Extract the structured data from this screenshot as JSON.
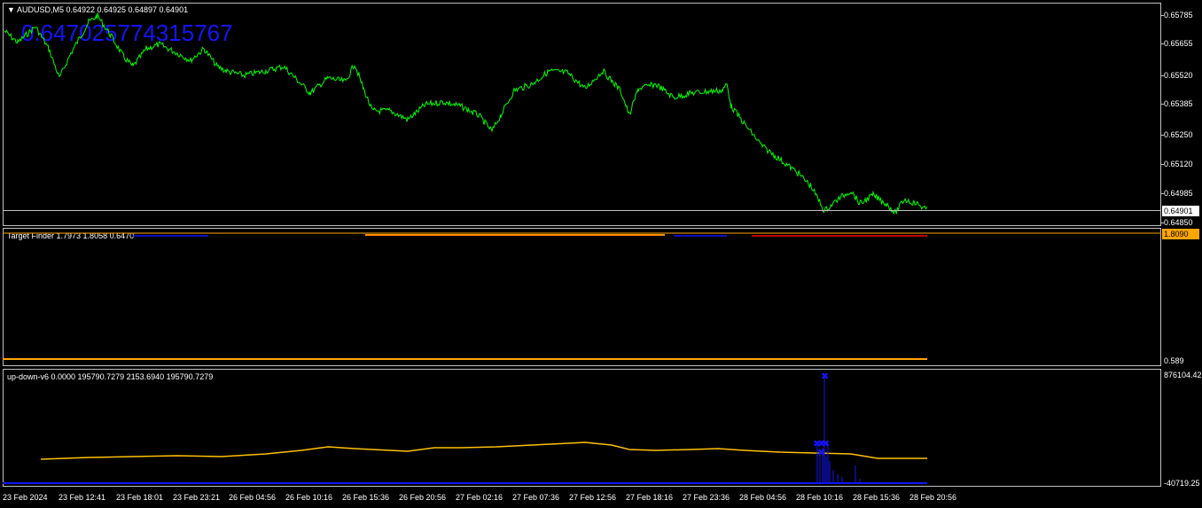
{
  "main": {
    "title": "AUDUSD,M5  0.64922 0.64925 0.64897 0.64901",
    "overlay_text": "0.6470257743157​67",
    "axis_ticks": [
      "0.65785",
      "0.65655",
      "0.65520",
      "0.65385",
      "0.65250",
      "0.65120",
      "0.64985",
      "0.64850"
    ],
    "current_price": "0.64901"
  },
  "target_finder": {
    "title": "Target Finder 1.7973 1.8058 0.6470",
    "price_box": "1.8090",
    "axis_low": "0.589"
  },
  "updown": {
    "title": "up-down-v6 0.0000 195790.7279 2153.6940 195790.7279",
    "axis_high": "876104.42",
    "axis_low": "-40719.25"
  },
  "time_axis": [
    "23 Feb 2024",
    "23 Feb 12:41",
    "23 Feb 18:01",
    "23 Feb 23:21",
    "26 Feb 04:56",
    "26 Feb 10:16",
    "26 Feb 15:36",
    "26 Feb 20:56",
    "27 Feb 02:16",
    "27 Feb 07:36",
    "27 Feb 12:56",
    "27 Feb 18:16",
    "27 Feb 23:36",
    "28 Feb 04:56",
    "28 Feb 10:16",
    "28 Feb 15:36",
    "28 Feb 20:56"
  ],
  "colors": {
    "price_line": "#00ff00",
    "target_line": "#ffa500",
    "target_red": "#ff0000",
    "blue": "#1414ff",
    "ma_line": "#ffc000"
  }
}
